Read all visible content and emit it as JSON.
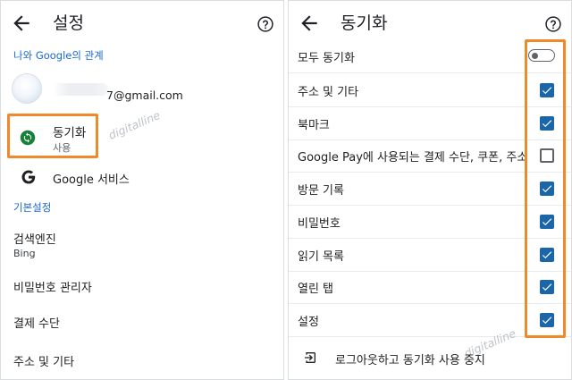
{
  "left_panel": {
    "title": "설정",
    "section_account": "나와 Google의 관계",
    "account_email": "7@gmail.com",
    "sync_label": "동기화",
    "sync_status": "사용",
    "google_services_label": "Google 서비스",
    "section_basic": "기본설정",
    "search_engine_label": "검색엔진",
    "search_engine_value": "Bing",
    "password_manager_label": "비밀번호 관리자",
    "payment_methods_label": "결제 수단",
    "addresses_label": "주소 및 기타",
    "watermark": "digitalline"
  },
  "right_panel": {
    "title": "동기화",
    "sync_all_label": "모두 동기화",
    "sync_all_enabled": false,
    "items": [
      {
        "label": "주소 및 기타",
        "checked": true
      },
      {
        "label": "북마크",
        "checked": true
      },
      {
        "label": "Google Pay에 사용되는 결제 수단, 쿠폰, 주소",
        "checked": false
      },
      {
        "label": "방문 기록",
        "checked": true
      },
      {
        "label": "비밀번호",
        "checked": true
      },
      {
        "label": "읽기 목록",
        "checked": true
      },
      {
        "label": "열린 탭",
        "checked": true
      },
      {
        "label": "설정",
        "checked": true
      }
    ],
    "logout_label": "로그아웃하고 동기화 사용 중지",
    "watermark": "digitalline"
  },
  "colors": {
    "highlight": "#ef8a2b",
    "checkbox_checked": "#1a66a8",
    "section_header": "#1967d2"
  },
  "icons": {
    "back": "arrow-left-icon",
    "help": "help-circle-icon",
    "sync": "sync-icon",
    "google": "google-g-icon",
    "logout": "logout-icon"
  }
}
